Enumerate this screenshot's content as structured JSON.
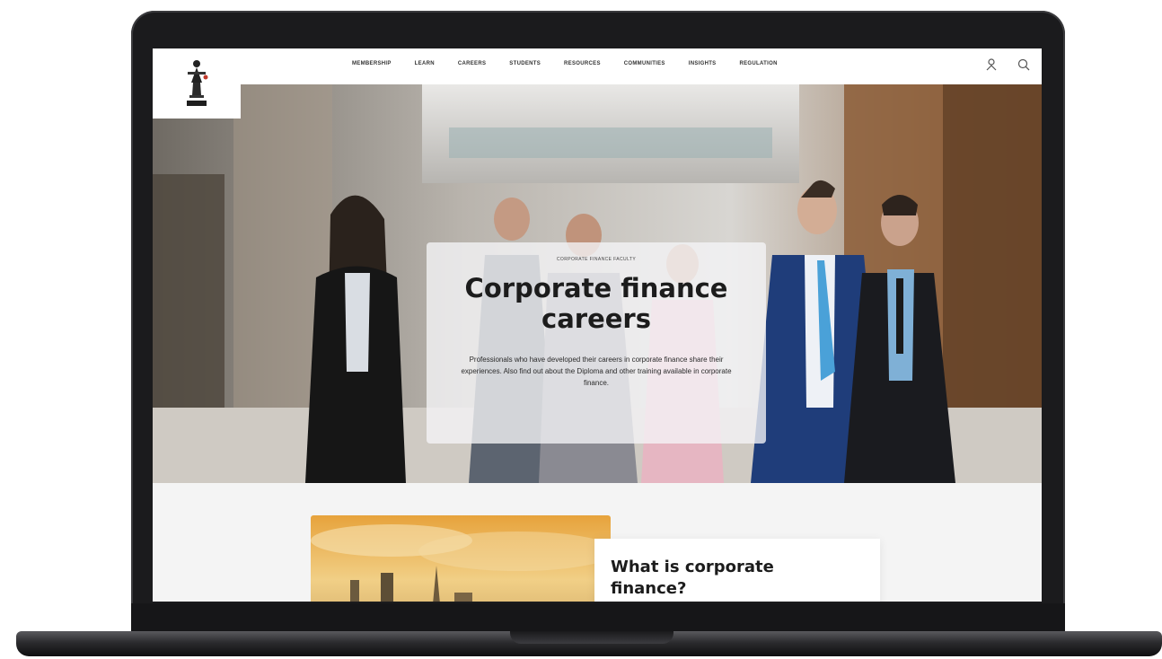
{
  "logo": {
    "name": "society-crest-logo"
  },
  "nav": {
    "items": [
      {
        "label": "MEMBERSHIP"
      },
      {
        "label": "LEARN"
      },
      {
        "label": "CAREERS"
      },
      {
        "label": "STUDENTS"
      },
      {
        "label": "RESOURCES"
      },
      {
        "label": "COMMUNITIES"
      },
      {
        "label": "INSIGHTS"
      },
      {
        "label": "REGULATION"
      }
    ],
    "icons": [
      "user-icon",
      "search-icon"
    ]
  },
  "hero": {
    "kicker": "CORPORATE FINANCE FACULTY",
    "title": "Corporate finance careers",
    "description": "Professionals who have developed their careers in corporate finance share their experiences. Also find out about the Diploma and other training available in corporate finance."
  },
  "feature": {
    "title": "What is corporate finance?"
  },
  "colors": {
    "bezel": "#1b1b1d",
    "text": "#1c1c1c",
    "background": "#f4f4f4"
  }
}
